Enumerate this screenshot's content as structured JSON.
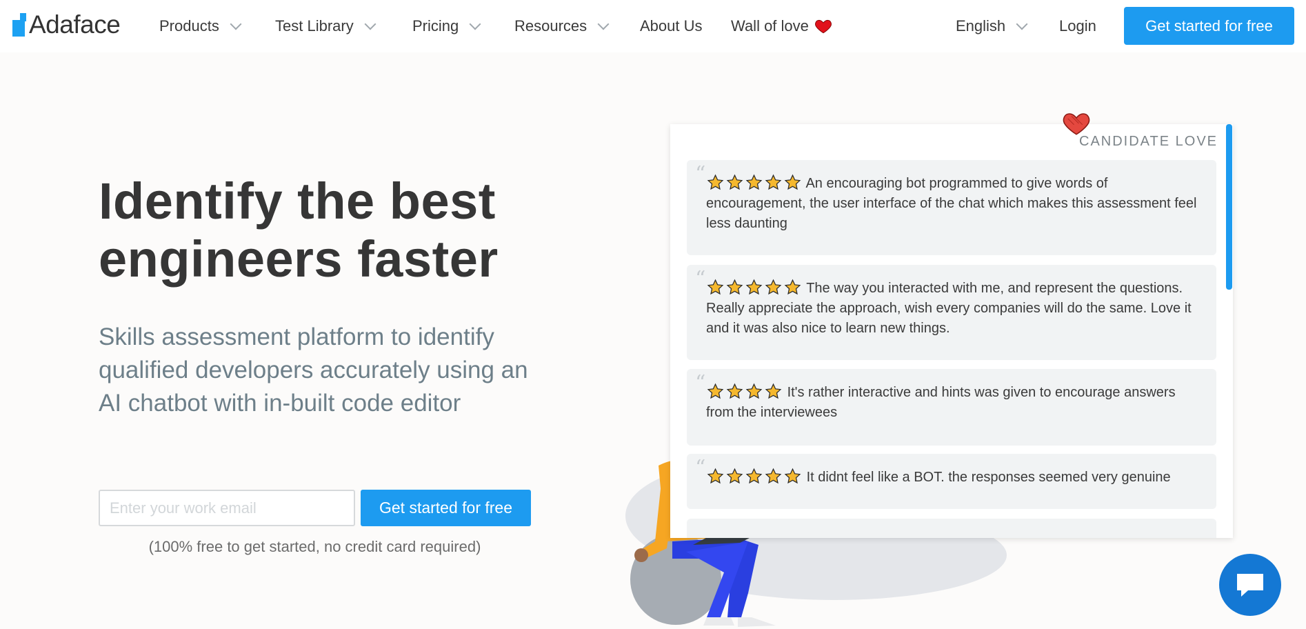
{
  "brand": {
    "name": "Adaface"
  },
  "nav": {
    "items": [
      {
        "label": "Products",
        "dropdown": true
      },
      {
        "label": "Test Library",
        "dropdown": true
      },
      {
        "label": "Pricing",
        "dropdown": true
      },
      {
        "label": "Resources",
        "dropdown": true
      },
      {
        "label": "About Us",
        "dropdown": false
      },
      {
        "label": "Wall of love",
        "dropdown": false
      }
    ],
    "language": "English",
    "login": "Login",
    "cta": "Get started for free"
  },
  "hero": {
    "title": "Identify the best engineers faster",
    "subtitle": "Skills assessment platform to identify qualified developers accurately using an AI chatbot with in-built code editor",
    "email_placeholder": "Enter your work email",
    "cta": "Get started for free",
    "note": "(100% free to get started, no credit card required)"
  },
  "reviews": {
    "label": "CANDIDATE LOVE",
    "items": [
      {
        "stars": 5,
        "text": "An encouraging bot programmed to give words of encouragement, the user interface of the chat which makes this assessment feel less daunting"
      },
      {
        "stars": 5,
        "text": "The way you interacted with me, and represent the questions. Really appreciate the approach, wish every companies will do the same. Love it and it was also nice to learn new things."
      },
      {
        "stars": 4,
        "text": "It's rather interactive and hints was given to encourage answers from the interviewees"
      },
      {
        "stars": 5,
        "text": "It didnt feel like a BOT. the responses seemed very genuine"
      }
    ]
  },
  "colors": {
    "accent": "#1d9bf0",
    "star": "#f5b82e",
    "heart": "#e63946",
    "chat": "#1478d4"
  },
  "icons": {
    "heart": "heart-icon",
    "star": "star-icon",
    "chevron": "chevron-down-icon",
    "chat": "chat-bubble-icon"
  }
}
